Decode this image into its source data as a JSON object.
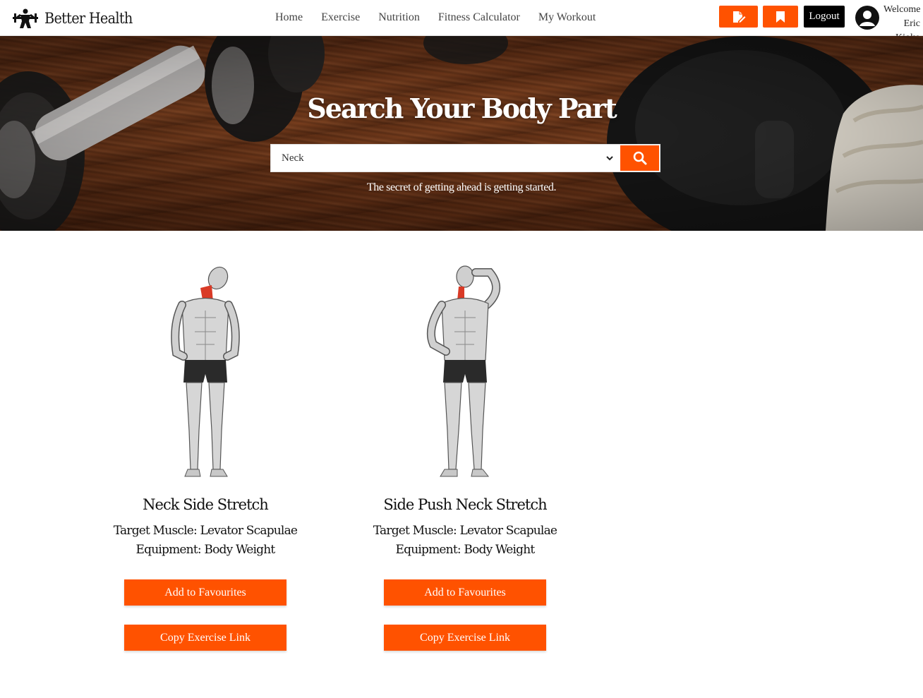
{
  "brand": {
    "name": "Better Health",
    "logo_icon": "bodybuilder-logo-icon"
  },
  "nav": {
    "links": [
      {
        "label": "Home"
      },
      {
        "label": "Exercise"
      },
      {
        "label": "Nutrition"
      },
      {
        "label": "Fitness Calculator"
      },
      {
        "label": "My Workout"
      }
    ],
    "actions": {
      "notes_icon": "edit-note-icon",
      "bookmark_icon": "bookmark-icon",
      "logout_label": "Logout",
      "avatar_icon": "user-avatar-icon",
      "accent_color": "#ff5200"
    },
    "welcome": {
      "line1": "Welcome",
      "line2": "Eric Kioko"
    }
  },
  "hero": {
    "title": "Search Your Body Part",
    "select_value": "Neck",
    "search_icon": "search-icon",
    "tagline": "The secret of getting ahead is getting started."
  },
  "exercises": [
    {
      "name": "Neck Side Stretch",
      "target": "Target Muscle: Levator Scapulae",
      "equipment": "Equipment: Body Weight",
      "fav_label": "Add to Favourites",
      "copy_label": "Copy Exercise Link"
    },
    {
      "name": "Side Push Neck Stretch",
      "target": "Target Muscle: Levator Scapulae",
      "equipment": "Equipment: Body Weight",
      "fav_label": "Add to Favourites",
      "copy_label": "Copy Exercise Link"
    }
  ]
}
